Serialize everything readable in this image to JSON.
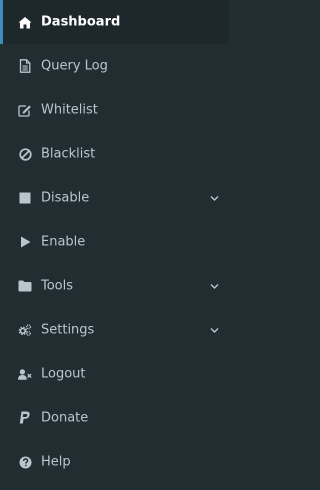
{
  "colors": {
    "sidebar_bg": "#222d32",
    "active_bg": "#1e282c",
    "active_accent": "#3c8dbc",
    "text": "#b8c7ce",
    "active_text": "#ffffff"
  },
  "menu": {
    "items": [
      {
        "label": "Dashboard",
        "icon": "home-icon",
        "active": true
      },
      {
        "label": "Query Log",
        "icon": "file-text-icon"
      },
      {
        "label": "Whitelist",
        "icon": "pencil-square-icon"
      },
      {
        "label": "Blacklist",
        "icon": "ban-icon"
      },
      {
        "label": "Disable",
        "icon": "stop-square-icon",
        "has_submenu": true
      },
      {
        "label": "Enable",
        "icon": "play-icon"
      },
      {
        "label": "Tools",
        "icon": "folder-icon",
        "has_submenu": true
      },
      {
        "label": "Settings",
        "icon": "cogs-icon",
        "has_submenu": true
      },
      {
        "label": "Logout",
        "icon": "user-times-icon"
      },
      {
        "label": "Donate",
        "icon": "paypal-icon"
      },
      {
        "label": "Help",
        "icon": "question-circle-icon"
      }
    ]
  }
}
